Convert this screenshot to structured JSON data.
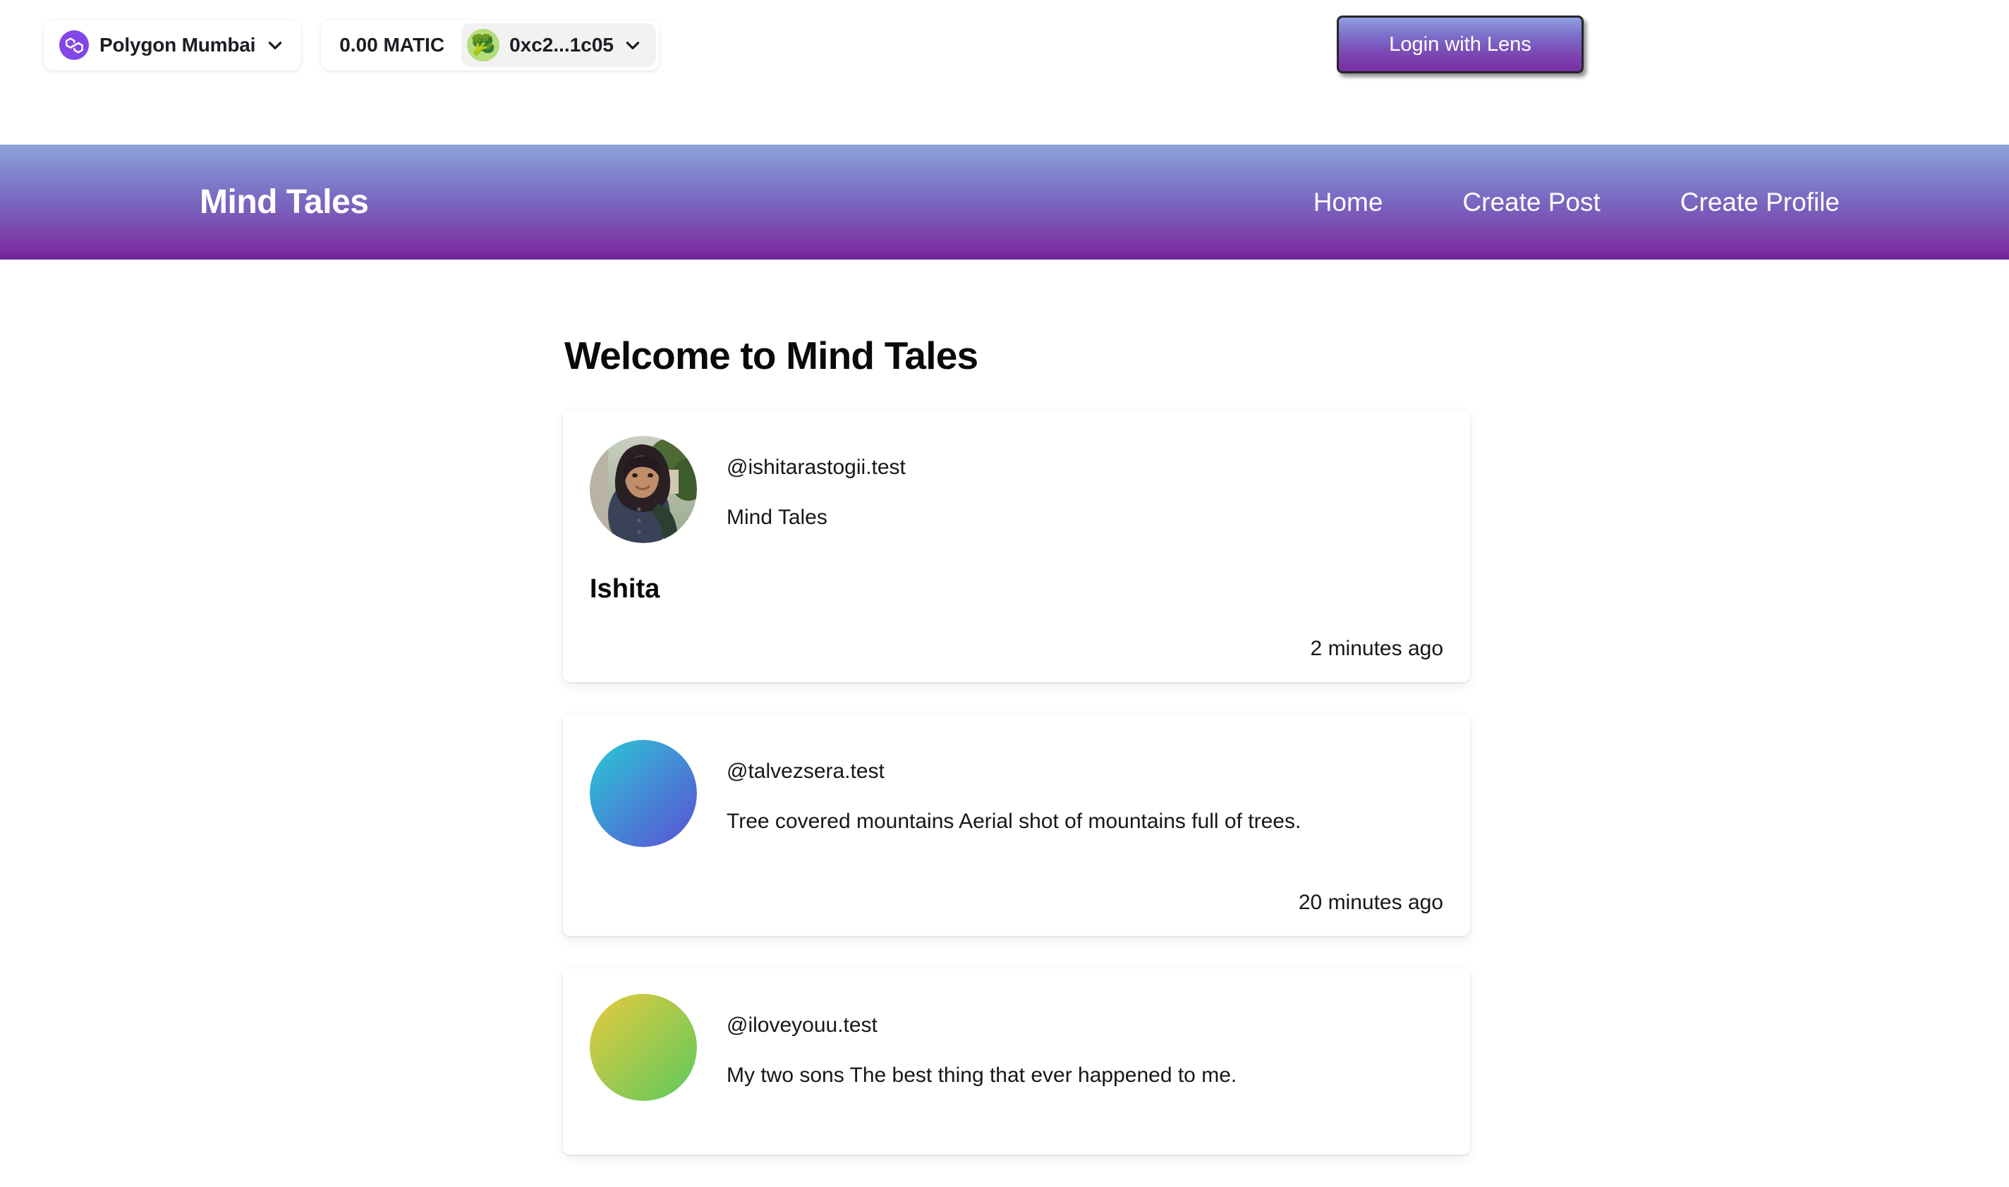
{
  "wallet": {
    "network_label": "Polygon Mumbai",
    "network_icon": "polygon-icon",
    "chevron_icon": "chevron-down-icon",
    "balance": "0.00 MATIC",
    "account_emoji": "🥦",
    "address": "0xc2...1c05",
    "accent_purple": "#8247e5",
    "pill_bg": "#f2f2f3",
    "emoji_circle": "#b3de7a"
  },
  "auth": {
    "login_label": "Login with Lens",
    "gradient_top": "#8f9ede",
    "gradient_bottom": "#7b2fa4",
    "border_color": "#262626"
  },
  "navbar": {
    "brand": "Mind Tales",
    "gradient_top": "#90a3d9",
    "gradient_bottom": "#6d2493",
    "links": [
      {
        "label": "Home"
      },
      {
        "label": "Create Post"
      },
      {
        "label": "Create Profile"
      }
    ]
  },
  "main": {
    "page_title": "Welcome to Mind Tales",
    "posts": [
      {
        "handle": "@ishitarastogii.test",
        "body": "Mind Tales",
        "title": "Ishita",
        "time": "2 minutes ago",
        "avatar_type": "photo"
      },
      {
        "handle": "@talvezsera.test",
        "body": "Tree covered mountains Aerial shot of mountains full of trees.",
        "title": "",
        "time": "20 minutes ago",
        "avatar_type": "gradient",
        "avatar_from": "#2bc9d4",
        "avatar_to": "#5b4fd6"
      },
      {
        "handle": "@iloveyouu.test",
        "body": "My two sons The best thing that ever happened to me.",
        "title": "",
        "time": "",
        "avatar_type": "gradient",
        "avatar_from": "#e8c93e",
        "avatar_to": "#5cc95c"
      }
    ]
  }
}
